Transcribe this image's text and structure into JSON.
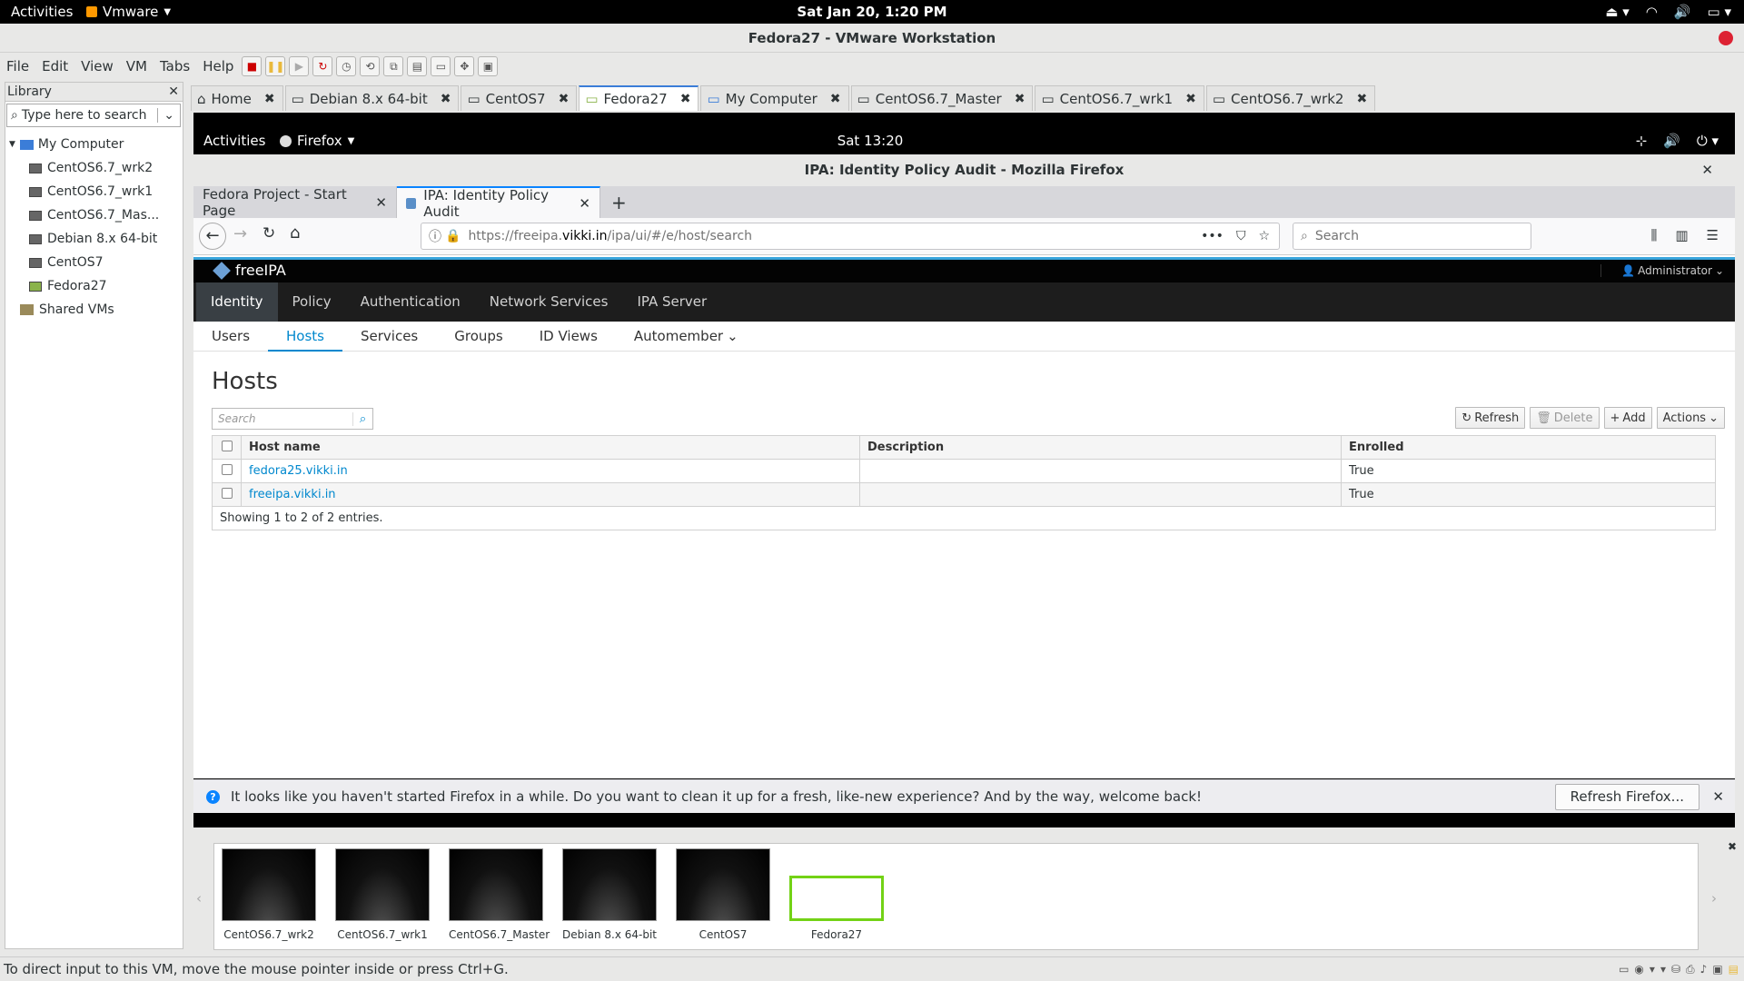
{
  "gnome": {
    "activities": "Activities",
    "app_menu": "Vmware",
    "clock": "Sat Jan 20,  1:20 PM"
  },
  "vmware": {
    "title": "Fedora27 - VMware Workstation",
    "menu": [
      "File",
      "Edit",
      "View",
      "VM",
      "Tabs",
      "Help"
    ],
    "library_title": "Library",
    "library_search_placeholder": "Type here to search",
    "tree": {
      "root": "My Computer",
      "children": [
        "CentOS6.7_wrk2",
        "CentOS6.7_wrk1",
        "CentOS6.7_Mas...",
        "Debian 8.x 64-bit",
        "CentOS7",
        "Fedora27"
      ],
      "shared": "Shared VMs"
    },
    "tabs": [
      "Home",
      "Debian 8.x 64-bit",
      "CentOS7",
      "Fedora27",
      "My Computer",
      "CentOS6.7_Master",
      "CentOS6.7_wrk1",
      "CentOS6.7_wrk2"
    ],
    "active_tab": "Fedora27",
    "thumbnails": [
      "CentOS6.7_wrk2",
      "CentOS6.7_wrk1",
      "CentOS6.7_Master",
      "Debian 8.x 64-bit",
      "CentOS7",
      "Fedora27"
    ],
    "status": "To direct input to this VM, move the mouse pointer inside or press Ctrl+G."
  },
  "guest": {
    "activities": "Activities",
    "app_menu": "Firefox",
    "clock": "Sat 13:20"
  },
  "firefox": {
    "window_title": "IPA: Identity Policy Audit - Mozilla Firefox",
    "tabs": [
      "Fedora Project - Start Page",
      "IPA: Identity Policy Audit"
    ],
    "url_prefix": "https://freeipa.",
    "url_domain": "vikki.in",
    "url_path": "/ipa/ui/#/e/host/search",
    "search_placeholder": "Search",
    "notification": "It looks like you haven't started Firefox in a while. Do you want to clean it up for a fresh, like-new experience? And by the way, welcome back!",
    "refresh_button": "Refresh Firefox..."
  },
  "ipa": {
    "brand": "freeIPA",
    "user": "Administrator",
    "nav": [
      "Identity",
      "Policy",
      "Authentication",
      "Network Services",
      "IPA Server"
    ],
    "subnav": [
      "Users",
      "Hosts",
      "Services",
      "Groups",
      "ID Views",
      "Automember"
    ],
    "heading": "Hosts",
    "search_placeholder": "Search",
    "buttons": {
      "refresh": "Refresh",
      "delete": "Delete",
      "add": "Add",
      "actions": "Actions"
    },
    "columns": [
      "Host name",
      "Description",
      "Enrolled"
    ],
    "rows": [
      {
        "host": "fedora25.vikki.in",
        "description": "",
        "enrolled": "True"
      },
      {
        "host": "freeipa.vikki.in",
        "description": "",
        "enrolled": "True"
      }
    ],
    "footer": "Showing 1 to 2 of 2 entries."
  }
}
